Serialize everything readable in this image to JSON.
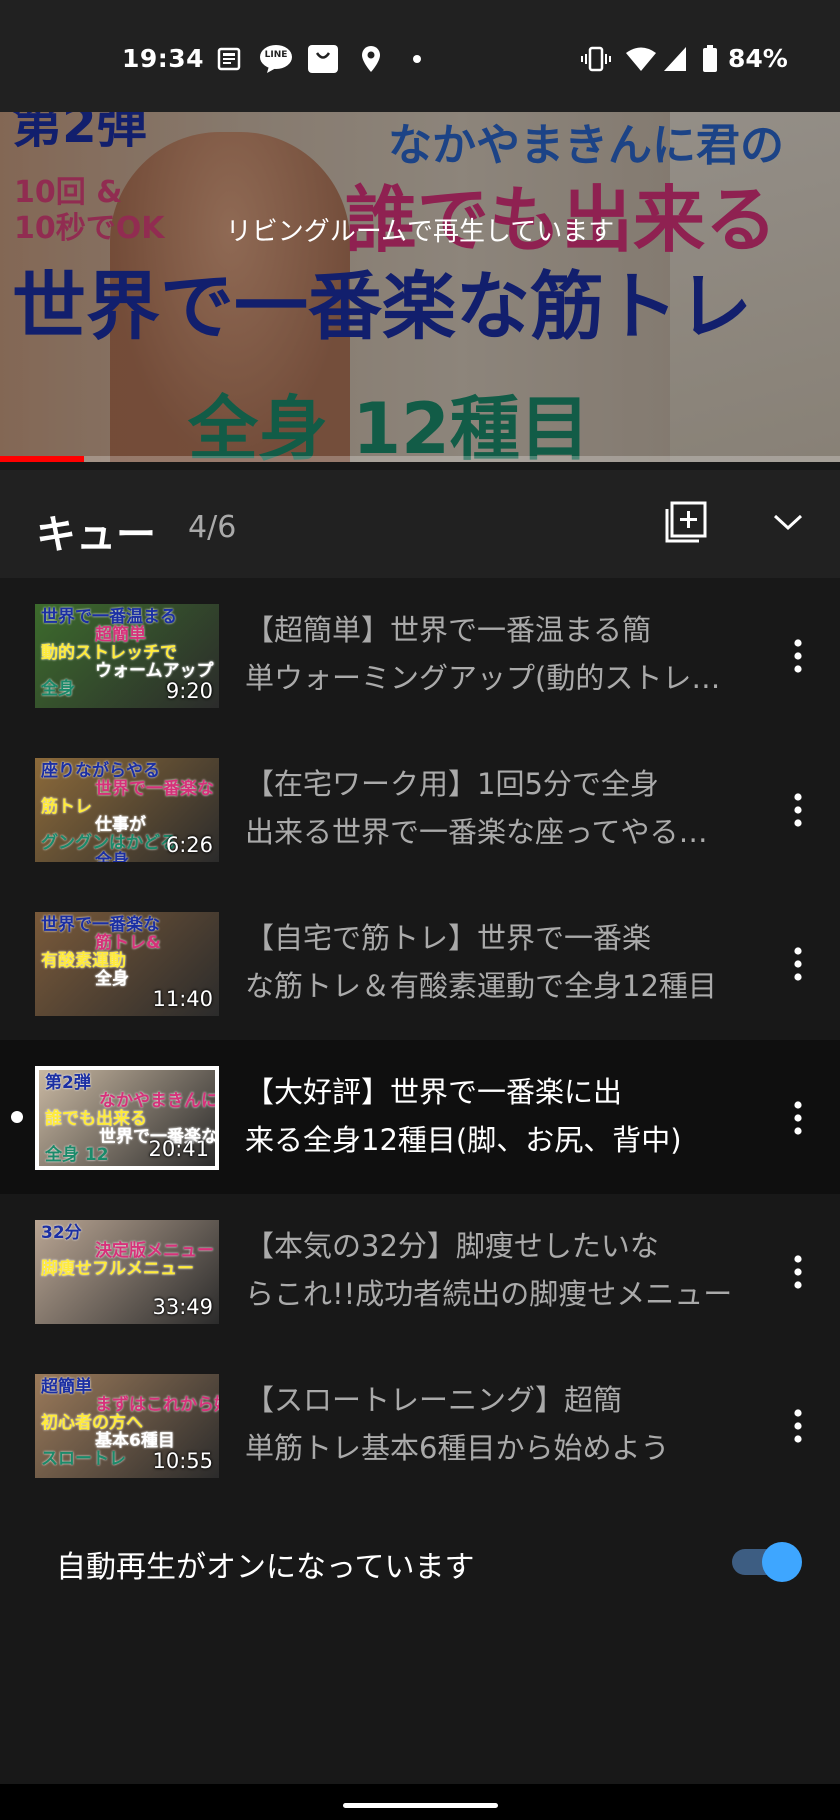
{
  "status_bar": {
    "time": "19:34",
    "left_icons": [
      "news-icon",
      "line-app-icon",
      "shopping-bag-icon",
      "location-icon",
      "dot-icon"
    ],
    "line_label": "LINE",
    "right_icons": [
      "vibrate-icon",
      "wifi-icon",
      "signal-icon",
      "battery-icon"
    ],
    "battery": "84%"
  },
  "player": {
    "thumb_text": {
      "top_left": "第2弾",
      "badge_1": "10回 &",
      "badge_2": "10秒でOK",
      "line1": "なかやまきんに君の",
      "line2": "誰でも出来る",
      "line3": "世界で一番楽な筋トレ",
      "line4": "全身 12種目"
    },
    "cast_message": "リビングルームで再生しています",
    "progress": 0.1
  },
  "queue": {
    "title": "キュー",
    "position": "4/6",
    "add_to_playlist": "add-to-playlist-icon",
    "collapse": "chevron-down-icon",
    "items": [
      {
        "title_line1": "【超簡単】世界で一番温まる簡",
        "title_line2": "単ウォーミングアップ(動的ストレッチ)",
        "duration": "9:20",
        "thumb_lines": [
          "世界で一番温まる",
          "超簡単",
          "動的ストレッチで",
          "ウォームアップ",
          "全身"
        ],
        "thumb_bg": "#3c6b2c"
      },
      {
        "title_line1": "【在宅ワーク用】1回5分で全身",
        "title_line2": "出来る世界で一番楽な座ってやる筋トレ",
        "duration": "6:26",
        "thumb_lines": [
          "座りながらやる",
          "世界で一番楽な",
          "筋トレ",
          "仕事が",
          "グングンはかどる",
          "全身"
        ],
        "thumb_bg": "#8c6a3a"
      },
      {
        "title_line1": "【自宅で筋トレ】世界で一番楽",
        "title_line2": "な筋トレ＆有酸素運動で全身12種目",
        "duration": "11:40",
        "thumb_lines": [
          "世界で一番楽な",
          "筋トレ&",
          "有酸素運動",
          "全身"
        ],
        "thumb_bg": "#7a5a3a"
      },
      {
        "title_line1": "【大好評】世界で一番楽に出",
        "title_line2": "来る全身12種目(脚、お尻、背中)",
        "duration": "20:41",
        "thumb_lines": [
          "第2弾",
          "なかやまきんに君の",
          "誰でも出来る",
          "世界で一番楽な筋トレ",
          "全身 12"
        ],
        "thumb_bg": "#c9b8a2",
        "active": true
      },
      {
        "title_line1": "【本気の32分】脚痩せしたいな",
        "title_line2": "らこれ!!成功者続出の脚痩せメニュー",
        "duration": "33:49",
        "thumb_lines": [
          "32分",
          "決定版メニュー",
          "脚痩せフルメニュー"
        ],
        "thumb_bg": "#b9a593"
      },
      {
        "title_line1": "【スロートレーニング】超簡",
        "title_line2": "単筋トレ基本6種目から始めよう",
        "duration": "10:55",
        "thumb_lines": [
          "超簡単",
          "まずはこれから始めよう",
          "初心者の方へ",
          "基本6種目",
          "スロートレ"
        ],
        "thumb_bg": "#9b7a5a"
      }
    ]
  },
  "autoplay": {
    "label": "自動再生がオンになっています",
    "enabled": true
  },
  "colors": {
    "background": "#181818",
    "header": "#212121",
    "accent": "#3ea6ff",
    "progress": "#ff0000"
  }
}
